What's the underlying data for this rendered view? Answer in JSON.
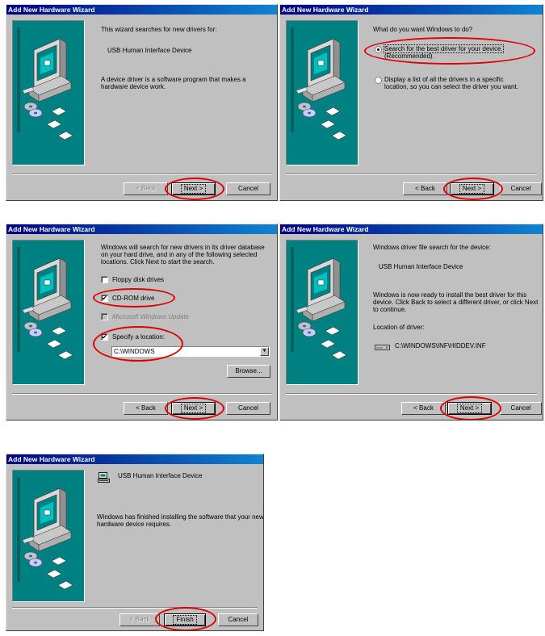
{
  "dialog_title": "Add New Hardware Wizard",
  "colors": {
    "titlebar": "#000080",
    "panel": "#008080",
    "highlight_circle": "#e00000"
  },
  "buttons": {
    "back": "< Back",
    "next": "Next >",
    "cancel": "Cancel",
    "finish": "Finish",
    "browse": "Browse..."
  },
  "step1": {
    "line1": "This wizard searches for new drivers for:",
    "device": "USB Human Interface Device",
    "desc_line1": "A device driver is a software program that makes a",
    "desc_line2": "hardware device work."
  },
  "step2": {
    "question": "What do you want Windows to do?",
    "option1_line1": "Search for the best driver for your device.",
    "option1_line2": "(Recommended).",
    "option1_selected": true,
    "option2_line1": "Display a list of all the drivers in a specific",
    "option2_line2": "location, so you can select the driver you want."
  },
  "step3": {
    "intro_line1": "Windows will search for new drivers in its driver database",
    "intro_line2": "on your hard drive, and in any of the following selected",
    "intro_line3": "locations. Click Next to start the search.",
    "floppy": "Floppy disk drives",
    "floppy_checked": false,
    "cdrom": "CD-ROM drive",
    "cdrom_checked": true,
    "winupdate": "Microsoft Windows Update",
    "winupdate_checked": false,
    "specify": "Specify a location:",
    "specify_checked": true,
    "location_value": "C:\\WINDOWS"
  },
  "step4": {
    "line1": "Windows driver file search for the device:",
    "device": "USB Human Interface Device",
    "ready_line1": "Windows is now ready to install the best driver for this",
    "ready_line2": "device. Click Back to select a different driver, or click Next",
    "ready_line3": "to continue.",
    "location_label": "Location of driver:",
    "driver_path": "C:\\WINDOWS\\INF\\HIDDEV.INF"
  },
  "step5": {
    "device": "USB Human Interface Device",
    "done_line1": "Windows has finished installing the software that your new",
    "done_line2": "hardware device requires."
  }
}
